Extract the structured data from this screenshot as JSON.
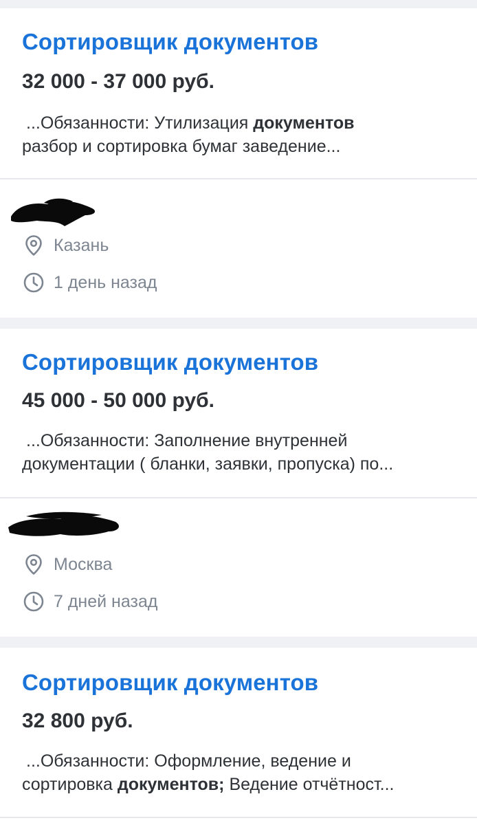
{
  "vacancies": [
    {
      "title": "Сортировщик документов",
      "salary": "32 000 - 37 000 руб.",
      "snippet_line1_pre": "...Обязанности: Утилизация ",
      "snippet_line1_bold": "документов",
      "snippet_line1_post": "",
      "snippet_line2_pre": "разбор и сортировка бумаг заведение...",
      "snippet_line2_bold": "",
      "snippet_line2_post": "",
      "city": "Казань",
      "posted": "1 день назад"
    },
    {
      "title": "Сортировщик документов",
      "salary": "45 000 - 50 000 руб.",
      "snippet_line1_pre": "...Обязанности: Заполнение внутренней",
      "snippet_line1_bold": "",
      "snippet_line1_post": "",
      "snippet_line2_pre": "документации ( бланки, заявки, пропуска) по...",
      "snippet_line2_bold": "",
      "snippet_line2_post": "",
      "city": "Москва",
      "posted": "7 дней назад"
    },
    {
      "title": "Сортировщик документов",
      "salary": "32 800 руб.",
      "snippet_line1_pre": "...Обязанности: Оформление, ведение и",
      "snippet_line1_bold": "",
      "snippet_line1_post": "",
      "snippet_line2_pre": "сортировка ",
      "snippet_line2_bold": "документов;",
      "snippet_line2_post": " Ведение отчётност...",
      "city": "",
      "posted": ""
    }
  ],
  "icons": {
    "location": "location-pin-icon",
    "time": "clock-icon"
  },
  "colors": {
    "title": "#1a73d9",
    "text": "#2e3236",
    "muted": "#7d8590",
    "background": "#eff1f4",
    "card": "#ffffff",
    "redaction": "#0a0a0a"
  }
}
